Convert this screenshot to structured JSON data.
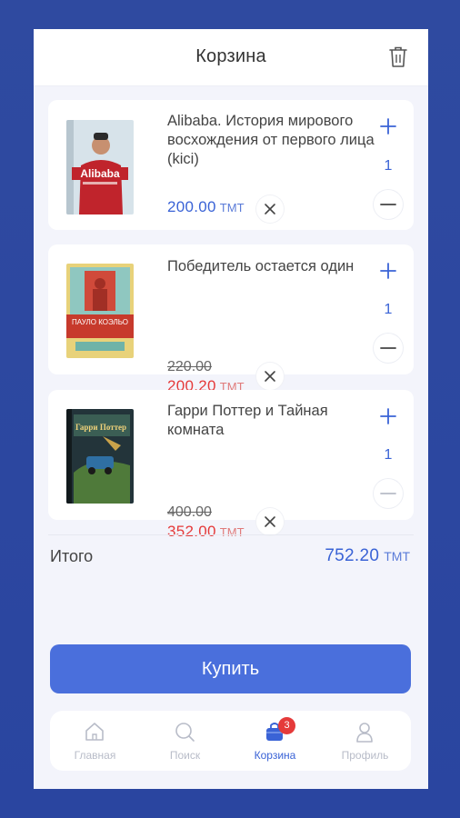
{
  "header": {
    "title": "Корзина"
  },
  "cart": {
    "items": [
      {
        "title": "Alibaba. История мирового восхождения от первого лица (kici)",
        "price": "200.00",
        "currency": "ТМТ",
        "old_price": "",
        "qty": "1"
      },
      {
        "title": "Победитель остается один",
        "price": "200.20",
        "currency": "ТМТ",
        "old_price": "220.00",
        "qty": "1"
      },
      {
        "title": "Гарри Поттер и Тайная комната",
        "price": "352.00",
        "currency": "ТМТ",
        "old_price": "400.00",
        "qty": "1"
      }
    ],
    "cover_texts": {
      "alibaba": "Alibaba",
      "coelho_author": "ПАУЛО КОЭЛЬО",
      "potter_title": "Гарри Поттер"
    }
  },
  "summary": {
    "total_label": "Итого",
    "total_value": "752.20",
    "currency": "ТМТ"
  },
  "actions": {
    "buy_label": "Купить"
  },
  "nav": {
    "items": [
      {
        "label": "Главная"
      },
      {
        "label": "Поиск"
      },
      {
        "label": "Корзина"
      },
      {
        "label": "Профиль"
      }
    ],
    "cart_badge": "3"
  },
  "colors": {
    "accent": "#3a63d6",
    "button": "#4a6fdc",
    "sale": "#e53a3a",
    "background": "#2f4aa0"
  }
}
